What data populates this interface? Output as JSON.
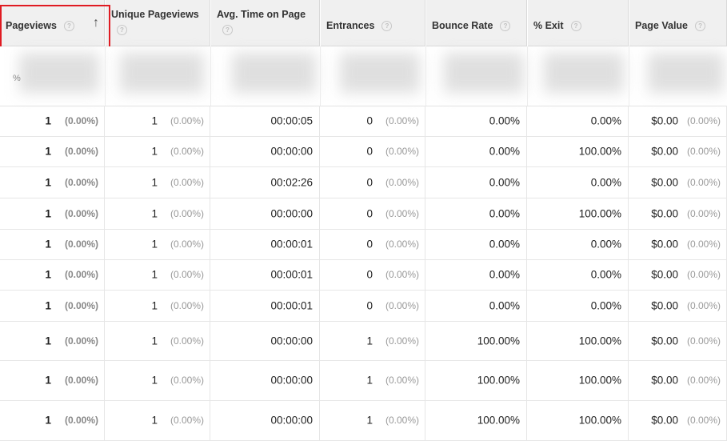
{
  "headers": {
    "pageviews": "Pageviews",
    "unique_pageviews": "Unique Pageviews",
    "avg_time": "Avg. Time on Page",
    "entrances": "Entrances",
    "bounce_rate": "Bounce Rate",
    "exit": "% Exit",
    "page_value": "Page Value",
    "help": "?",
    "sort_arrow": "↑"
  },
  "summary": {
    "pct_sign": "%"
  },
  "rows": [
    {
      "pv": "1",
      "pv_pct": "(0.00%)",
      "upv": "1",
      "upv_pct": "(0.00%)",
      "time": "00:00:05",
      "ent": "0",
      "ent_pct": "(0.00%)",
      "bounce": "0.00%",
      "exit": "0.00%",
      "val": "$0.00",
      "val_pct": "(0.00%)"
    },
    {
      "pv": "1",
      "pv_pct": "(0.00%)",
      "upv": "1",
      "upv_pct": "(0.00%)",
      "time": "00:00:00",
      "ent": "0",
      "ent_pct": "(0.00%)",
      "bounce": "0.00%",
      "exit": "100.00%",
      "val": "$0.00",
      "val_pct": "(0.00%)"
    },
    {
      "pv": "1",
      "pv_pct": "(0.00%)",
      "upv": "1",
      "upv_pct": "(0.00%)",
      "time": "00:02:26",
      "ent": "0",
      "ent_pct": "(0.00%)",
      "bounce": "0.00%",
      "exit": "0.00%",
      "val": "$0.00",
      "val_pct": "(0.00%)"
    },
    {
      "pv": "1",
      "pv_pct": "(0.00%)",
      "upv": "1",
      "upv_pct": "(0.00%)",
      "time": "00:00:00",
      "ent": "0",
      "ent_pct": "(0.00%)",
      "bounce": "0.00%",
      "exit": "100.00%",
      "val": "$0.00",
      "val_pct": "(0.00%)"
    },
    {
      "pv": "1",
      "pv_pct": "(0.00%)",
      "upv": "1",
      "upv_pct": "(0.00%)",
      "time": "00:00:01",
      "ent": "0",
      "ent_pct": "(0.00%)",
      "bounce": "0.00%",
      "exit": "0.00%",
      "val": "$0.00",
      "val_pct": "(0.00%)"
    },
    {
      "pv": "1",
      "pv_pct": "(0.00%)",
      "upv": "1",
      "upv_pct": "(0.00%)",
      "time": "00:00:01",
      "ent": "0",
      "ent_pct": "(0.00%)",
      "bounce": "0.00%",
      "exit": "0.00%",
      "val": "$0.00",
      "val_pct": "(0.00%)"
    },
    {
      "pv": "1",
      "pv_pct": "(0.00%)",
      "upv": "1",
      "upv_pct": "(0.00%)",
      "time": "00:00:01",
      "ent": "0",
      "ent_pct": "(0.00%)",
      "bounce": "0.00%",
      "exit": "0.00%",
      "val": "$0.00",
      "val_pct": "(0.00%)"
    },
    {
      "pv": "1",
      "pv_pct": "(0.00%)",
      "upv": "1",
      "upv_pct": "(0.00%)",
      "time": "00:00:00",
      "ent": "1",
      "ent_pct": "(0.00%)",
      "bounce": "100.00%",
      "exit": "100.00%",
      "val": "$0.00",
      "val_pct": "(0.00%)"
    },
    {
      "pv": "1",
      "pv_pct": "(0.00%)",
      "upv": "1",
      "upv_pct": "(0.00%)",
      "time": "00:00:00",
      "ent": "1",
      "ent_pct": "(0.00%)",
      "bounce": "100.00%",
      "exit": "100.00%",
      "val": "$0.00",
      "val_pct": "(0.00%)"
    },
    {
      "pv": "1",
      "pv_pct": "(0.00%)",
      "upv": "1",
      "upv_pct": "(0.00%)",
      "time": "00:00:00",
      "ent": "1",
      "ent_pct": "(0.00%)",
      "bounce": "100.00%",
      "exit": "100.00%",
      "val": "$0.00",
      "val_pct": "(0.00%)"
    }
  ]
}
